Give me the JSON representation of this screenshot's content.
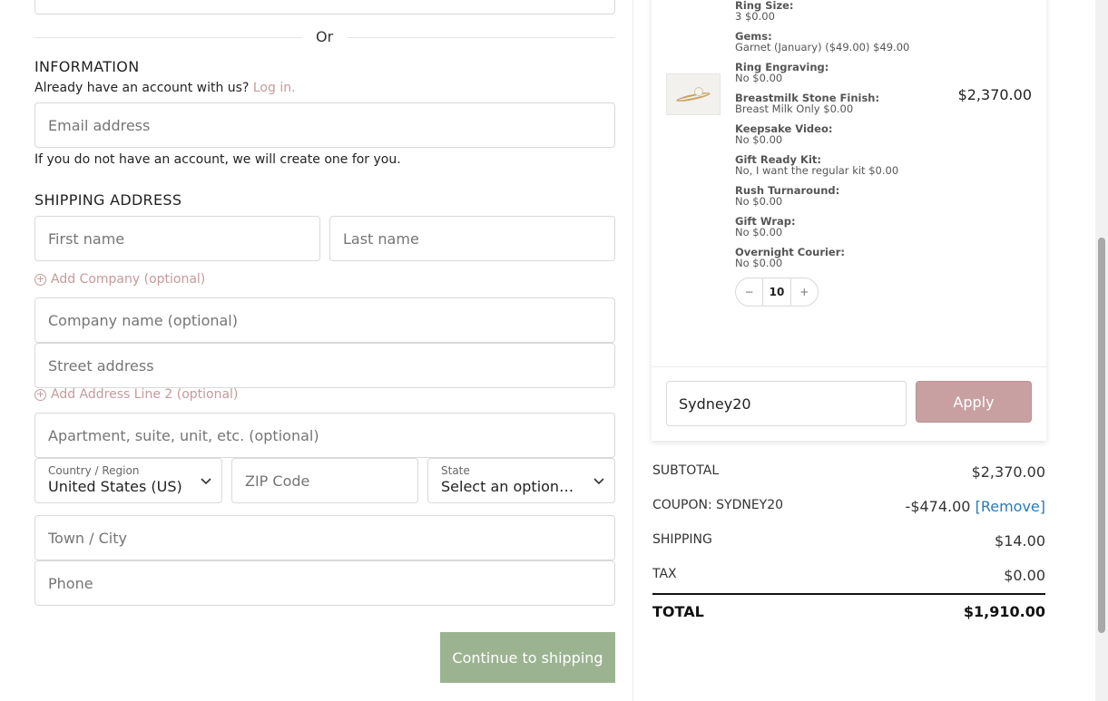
{
  "information": {
    "or_text": "Or",
    "title": "INFORMATION",
    "account_prompt": "Already have an account with us?",
    "login_link": "Log in.",
    "email_placeholder": "Email address",
    "account_note": "If you do not have an account, we will create one for you."
  },
  "shipping": {
    "title": "SHIPPING ADDRESS",
    "first_name_placeholder": "First name",
    "last_name_placeholder": "Last name",
    "add_company_link": "Add Company (optional)",
    "company_placeholder": "Company name (optional)",
    "street_placeholder": "Street address",
    "add_line2_link": "Add Address Line 2 (optional)",
    "apartment_placeholder": "Apartment, suite, unit, etc. (optional)",
    "country_label": "Country / Region",
    "country_value": "United States (US)",
    "zip_placeholder": "ZIP Code",
    "state_label": "State",
    "state_value": "Select an option…",
    "city_placeholder": "Town / City",
    "phone_placeholder": "Phone",
    "continue_button": "Continue to shipping"
  },
  "cart": {
    "options": [
      {
        "key": "Ring Size:",
        "value": "3 $0.00"
      },
      {
        "key": "Gems:",
        "value": "Garnet (January) ($49.00) $49.00"
      },
      {
        "key": "Ring Engraving:",
        "value": "No $0.00"
      },
      {
        "key": "Breastmilk Stone Finish:",
        "value": "Breast Milk Only $0.00"
      },
      {
        "key": "Keepsake Video:",
        "value": "No $0.00"
      },
      {
        "key": "Gift Ready Kit:",
        "value": "No, I want the regular kit $0.00"
      },
      {
        "key": "Rush Turnaround:",
        "value": "No $0.00"
      },
      {
        "key": "Gift Wrap:",
        "value": "No $0.00"
      },
      {
        "key": "Overnight Courier:",
        "value": "No $0.00"
      }
    ],
    "line_price": "$2,370.00",
    "quantity": {
      "minus": "−",
      "value": "10",
      "plus": "+"
    },
    "coupon_value": "Sydney20",
    "apply_button": "Apply"
  },
  "totals": {
    "subtotal_label": "SUBTOTAL",
    "subtotal_value": "$2,370.00",
    "coupon_label": "COUPON: SYDNEY20",
    "coupon_value": "-$474.00",
    "coupon_remove": "[Remove]",
    "shipping_label": "SHIPPING",
    "shipping_value": "$14.00",
    "tax_label": "TAX",
    "tax_value": "$0.00",
    "total_label": "TOTAL",
    "total_value": "$1,910.00"
  },
  "icons": {
    "plus_circle": "plus-circle-icon",
    "chevron": "chevron-down-icon"
  }
}
